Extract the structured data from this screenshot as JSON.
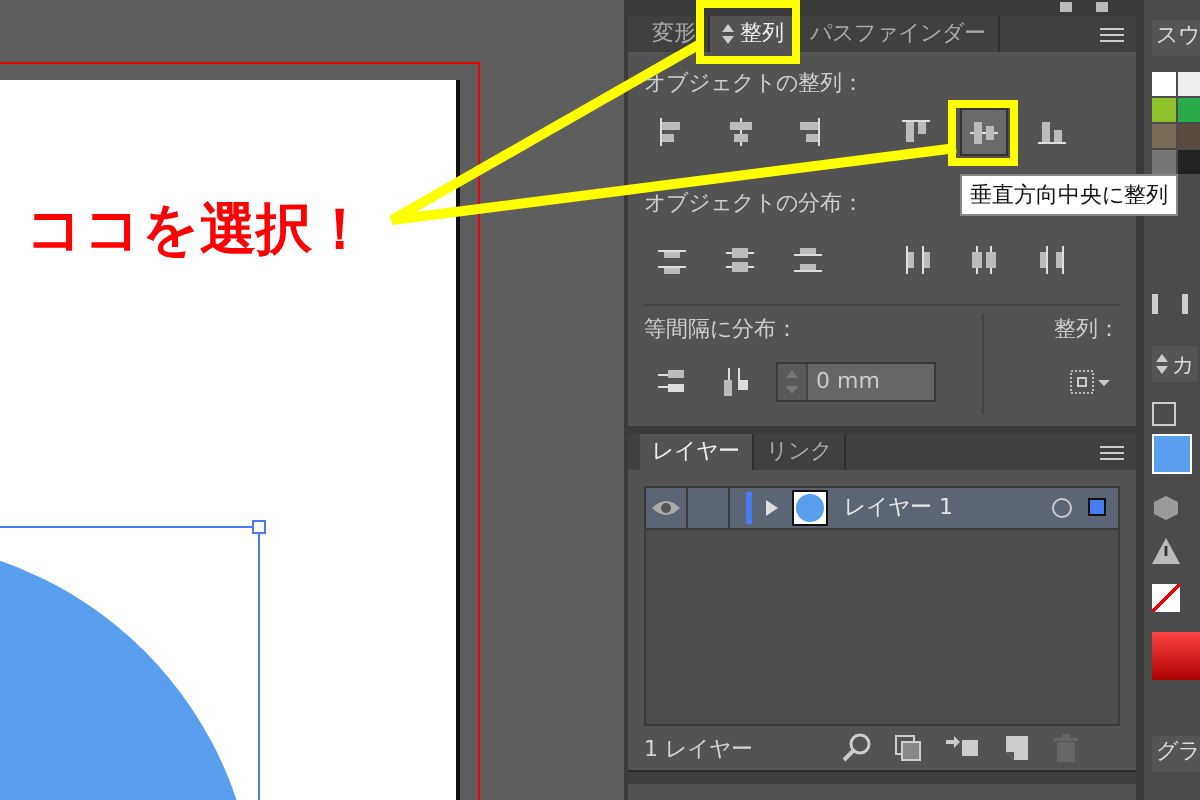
{
  "canvas": {
    "callout": "ココを選択！"
  },
  "align_panel": {
    "tabs": [
      {
        "label": "変形",
        "selected": false
      },
      {
        "label": "整列",
        "selected": true
      },
      {
        "label": "パスファインダー",
        "selected": false
      }
    ],
    "align_objects_label": "オブジェクトの整列：",
    "align_buttons": [
      {
        "kind": "left",
        "selected": false
      },
      {
        "kind": "hcenter",
        "selected": false
      },
      {
        "kind": "right",
        "selected": false
      },
      {
        "kind": "top",
        "selected": false
      },
      {
        "kind": "vcenter",
        "selected": true
      },
      {
        "kind": "bottom",
        "selected": false
      }
    ],
    "tooltip": "垂直方向中央に整列",
    "distribute_label": "オブジェクトの分布：",
    "distribute_buttons": [
      {
        "kind": "dtop"
      },
      {
        "kind": "dvcenter"
      },
      {
        "kind": "dbottom"
      },
      {
        "kind": "dleft"
      },
      {
        "kind": "dhcenter"
      },
      {
        "kind": "dright"
      }
    ],
    "spacing_label": "等間隔に分布：",
    "align_to_label": "整列：",
    "spacing_value": "0 mm"
  },
  "layers_panel": {
    "tabs": [
      {
        "label": "レイヤー",
        "selected": true
      },
      {
        "label": "リンク",
        "selected": false
      }
    ],
    "layers": [
      {
        "name": "レイヤー 1",
        "visible": true,
        "expanded": false,
        "selected": true
      }
    ],
    "count": "1 レイヤー"
  },
  "side_panel": {
    "swatches_tab": "スウ",
    "color_tab": "カ",
    "gradient_tab": "グラ"
  }
}
